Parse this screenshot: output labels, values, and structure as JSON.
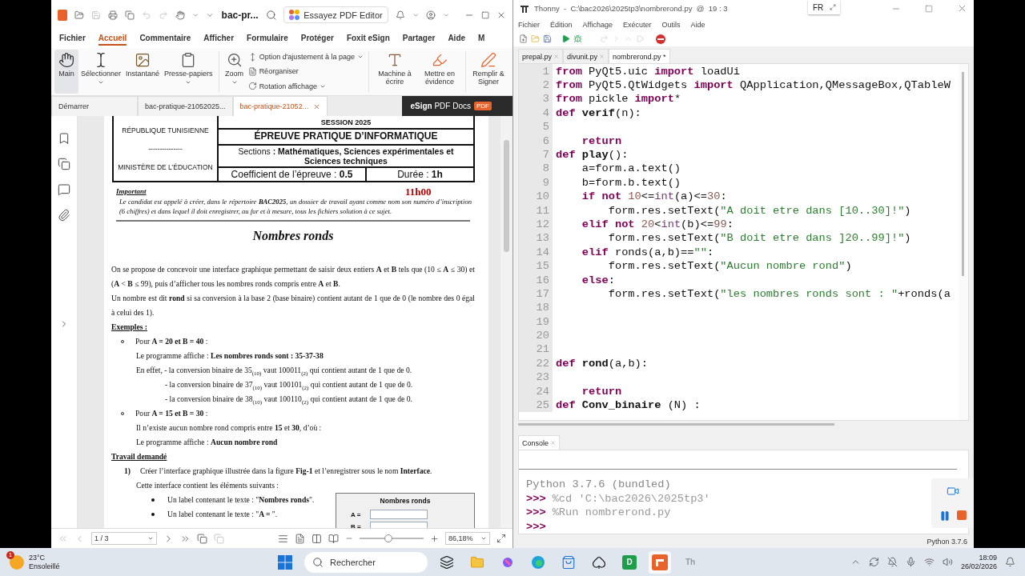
{
  "pdf_window": {
    "title": "bac-pr...",
    "promo_button": "Essayez PDF Editor",
    "menu_tabs": [
      {
        "label": "Fichier",
        "selected": false
      },
      {
        "label": "Accueil",
        "selected": true
      },
      {
        "label": "Commentaire",
        "selected": false
      },
      {
        "label": "Afficher",
        "selected": false
      },
      {
        "label": "Formulaire",
        "selected": false
      },
      {
        "label": "Protéger",
        "selected": false
      },
      {
        "label": "Foxit eSign",
        "selected": false
      },
      {
        "label": "Partager",
        "selected": false
      },
      {
        "label": "Aide",
        "selected": false
      },
      {
        "label": "M",
        "selected": false
      }
    ],
    "tools": [
      {
        "kind": "hand",
        "label": "Main",
        "selected": true,
        "dropdown": false
      },
      {
        "kind": "select",
        "label": "Sélectionner",
        "selected": false,
        "dropdown": true
      },
      {
        "kind": "snapshot",
        "label": "Instantané",
        "selected": false,
        "dropdown": false
      },
      {
        "kind": "clipboard",
        "label": "Presse-papiers",
        "selected": false,
        "dropdown": true
      },
      {
        "kind": "zoom",
        "label": "Zoom",
        "selected": false,
        "dropdown": true
      }
    ],
    "view_options": [
      {
        "kind": "fit",
        "label": "Option d'ajustement à la page",
        "dropdown": true
      },
      {
        "kind": "reorder",
        "label": "Réorganiser",
        "dropdown": false
      },
      {
        "kind": "rotate",
        "label": "Rotation affichage",
        "dropdown": true
      }
    ],
    "edit_tools": [
      {
        "kind": "typewriter",
        "label": "Machine à écrire"
      },
      {
        "kind": "highlight",
        "label": "Mettre en évidence"
      },
      {
        "kind": "sign",
        "label": "Remplir & Signer"
      }
    ],
    "doc_tabs": [
      {
        "label": "Démarrer",
        "selected": false
      },
      {
        "label": "bac-pratique-21052025...",
        "selected": false
      },
      {
        "label": "bac-pratique-21052...",
        "selected": true
      }
    ],
    "esign_banner": {
      "text": "**eSign** PDF Docs",
      "badge": "PDF"
    },
    "document": {
      "header_left": [
        "RÉPUBLIQUE TUNISIENNE",
        "---------------",
        "MINISTÈRE DE L’ÉDUCATION"
      ],
      "session": "SESSION 2025",
      "exam_title": "ÉPREUVE PRATIQUE D’INFORMATIQUE",
      "sections": "Sections **: Mathématiques, Sciences expérimentales et Sciences techniques**",
      "coefficient": "Coefficient de l’épreuve : **0.5**",
      "duration": "Durée : **1h**",
      "important_label": "Important",
      "note": "Le candidat est appelé à créer, dans le répertoire **BAC2025**, un dossier de travail ayant comme nom son numéro d’inscription (6 chiffres) et dans lequel il doit enregistrer, au fur et à mesure, tous les fichiers solution à ce sujet.",
      "time_note": "11h00",
      "title": "Nombres ronds",
      "blocks": [
        {
          "kind": "para",
          "text": "On se propose de concevoir une interface graphique permettant de saisir deux entiers **A** et **B** tels que (10 ≤ **A** ≤ 30) et (**A** < **B** ≤ 99), puis d’afficher tous les nombres ronds compris entre **A** et **B**."
        },
        {
          "kind": "para",
          "text": "Un nombre est dit **rond** si sa conversion à la base 2 (base binaire) contient autant de 1 que de 0 (le nombre des 0 égal à celui des 1)."
        },
        {
          "kind": "heading",
          "text": "Exemples :"
        },
        {
          "kind": "circle",
          "text": "Pour **A = 20 et B = 40** :"
        },
        {
          "kind": "indent",
          "text": "Le programme affiche : **Les nombres ronds sont : 35-37-38**"
        },
        {
          "kind": "indent",
          "text": "En effet, - la conversion binaire de 35$_{(10)}$ vaut 100011$_{(2)}$ qui contient autant de 1 que de 0."
        },
        {
          "kind": "subindent",
          "text": "- la conversion binaire de 37$_{(10)}$ vaut 100101$_{(2)}$ qui contient autant de 1 que de 0."
        },
        {
          "kind": "subindent",
          "text": "- la conversion binaire de 38$_{(10)}$ vaut 100110$_{(2)}$ qui contient autant de 1 que de 0."
        },
        {
          "kind": "circle",
          "text": "Pour **A = 15 et B = 30** :"
        },
        {
          "kind": "indent",
          "text": "Il n’existe aucun nombre rond compris entre **15** et **30**, d’où :"
        },
        {
          "kind": "indent",
          "text": "Le programme affiche : **Aucun nombre rond**"
        },
        {
          "kind": "heading",
          "text": "Travail demandé"
        },
        {
          "kind": "numbered",
          "number": "1)",
          "text": "Créer l’interface graphique illustrée dans la figure **Fig-1** et l’enregistrer sous le nom **Interface**."
        },
        {
          "kind": "indent",
          "text": "Cette interface contient les éléments suivants :"
        }
      ],
      "elements": [
        "Un label contenant le texte : \"**Nombres ronds**\".",
        "Un label contenant le texte : \"**A =** \"."
      ],
      "figure": {
        "title": "Nombres ronds",
        "labels": [
          "A =",
          "B ="
        ]
      }
    },
    "status": {
      "page": "1 / 3",
      "zoom": "86,18%",
      "level": 0.45
    }
  },
  "thonny": {
    "title": "Thonny  -  C:\\bac2026\\2025tp3\\nombrerond.py  @  19 : 3",
    "language": "FR",
    "menu": [
      "Fichier",
      "Édition",
      "Affichage",
      "Exécuter",
      "Outils",
      "Aide"
    ],
    "tabs": [
      {
        "label": "prepal.py",
        "selected": false
      },
      {
        "label": "divunit.py",
        "selected": false
      },
      {
        "label": "nombrerond.py *",
        "selected": true
      }
    ],
    "lines": [
      {
        "number": "1",
        "tokens": [
          {
            "kind": "kw",
            "text": "from"
          },
          {
            "kind": "txt",
            "text": " PyQt5.uic "
          },
          {
            "kind": "kw",
            "text": "import"
          },
          {
            "kind": "txt",
            "text": " loadUi"
          }
        ]
      },
      {
        "number": "2",
        "tokens": [
          {
            "kind": "kw",
            "text": "from"
          },
          {
            "kind": "txt",
            "text": " PyQt5.QtWidgets "
          },
          {
            "kind": "kw",
            "text": "import"
          },
          {
            "kind": "txt",
            "text": " QApplication,QMessageBox,QTableW"
          }
        ]
      },
      {
        "number": "3",
        "tokens": [
          {
            "kind": "kw",
            "text": "from"
          },
          {
            "kind": "txt",
            "text": " pickle "
          },
          {
            "kind": "kw",
            "text": "import"
          },
          {
            "kind": "txt",
            "text": "*"
          }
        ]
      },
      {
        "number": "4",
        "tokens": [
          {
            "kind": "kw",
            "text": "def"
          },
          {
            "kind": "fn",
            "text": " verif"
          },
          {
            "kind": "txt",
            "text": "(n):"
          }
        ]
      },
      {
        "number": "5"
      },
      {
        "number": "6",
        "tokens": [
          {
            "kind": "kw",
            "text": "    return"
          }
        ]
      },
      {
        "number": "7",
        "tokens": [
          {
            "kind": "kw",
            "text": "def"
          },
          {
            "kind": "fn",
            "text": " play"
          },
          {
            "kind": "txt",
            "text": "():"
          }
        ]
      },
      {
        "number": "8",
        "tokens": [
          {
            "kind": "txt",
            "text": "    a=form.a.text()"
          }
        ]
      },
      {
        "number": "9",
        "tokens": [
          {
            "kind": "txt",
            "text": "    b=form.b.text()"
          }
        ]
      },
      {
        "number": "10",
        "tokens": [
          {
            "kind": "kw",
            "text": "    if"
          },
          {
            "kind": "kw",
            "text": " not"
          },
          {
            "kind": "num",
            "text": " 10"
          },
          {
            "kind": "txt",
            "text": "<="
          },
          {
            "kind": "builtin",
            "text": "int"
          },
          {
            "kind": "txt",
            "text": "(a)<="
          },
          {
            "kind": "num",
            "text": "30"
          },
          {
            "kind": "txt",
            "text": ":"
          }
        ]
      },
      {
        "number": "11",
        "tokens": [
          {
            "kind": "txt",
            "text": "        form.res.setText("
          },
          {
            "kind": "str",
            "text": "\"A doit etre dans [10..30]!\""
          },
          {
            "kind": "txt",
            "text": ")"
          }
        ]
      },
      {
        "number": "12",
        "tokens": [
          {
            "kind": "kw",
            "text": "    elif"
          },
          {
            "kind": "kw",
            "text": " not"
          },
          {
            "kind": "num",
            "text": " 20"
          },
          {
            "kind": "txt",
            "text": "<"
          },
          {
            "kind": "builtin",
            "text": "int"
          },
          {
            "kind": "txt",
            "text": "(b)<="
          },
          {
            "kind": "num",
            "text": "99"
          },
          {
            "kind": "txt",
            "text": ":"
          }
        ]
      },
      {
        "number": "13",
        "tokens": [
          {
            "kind": "txt",
            "text": "        form.res.setText("
          },
          {
            "kind": "str",
            "text": "\"B doit etre dans ]20..99]!\""
          },
          {
            "kind": "txt",
            "text": ")"
          }
        ]
      },
      {
        "number": "14",
        "tokens": [
          {
            "kind": "kw",
            "text": "    elif"
          },
          {
            "kind": "txt",
            "text": " ronds(a,b)=="
          },
          {
            "kind": "str",
            "text": "\"\""
          },
          {
            "kind": "txt",
            "text": ":"
          }
        ]
      },
      {
        "number": "15",
        "tokens": [
          {
            "kind": "txt",
            "text": "        form.res.setText("
          },
          {
            "kind": "str",
            "text": "\"Aucun nombre rond\""
          },
          {
            "kind": "txt",
            "text": ")"
          }
        ]
      },
      {
        "number": "16",
        "tokens": [
          {
            "kind": "kw",
            "text": "    else"
          },
          {
            "kind": "txt",
            "text": ":"
          }
        ]
      },
      {
        "number": "17",
        "tokens": [
          {
            "kind": "txt",
            "text": "        form.res.setText("
          },
          {
            "kind": "str",
            "text": "\"les nombres ronds sont : \""
          },
          {
            "kind": "txt",
            "text": "+ronds(a"
          }
        ]
      },
      {
        "number": "18"
      },
      {
        "number": "19"
      },
      {
        "number": "20"
      },
      {
        "number": "21"
      },
      {
        "number": "22",
        "tokens": [
          {
            "kind": "kw",
            "text": "def"
          },
          {
            "kind": "fn",
            "text": " rond"
          },
          {
            "kind": "txt",
            "text": "(a,b):"
          }
        ]
      },
      {
        "number": "23"
      },
      {
        "number": "24",
        "tokens": [
          {
            "kind": "kw",
            "text": "    return"
          }
        ]
      },
      {
        "number": "25",
        "tokens": [
          {
            "kind": "kw",
            "text": "def"
          },
          {
            "kind": "fn",
            "text": " Conv_binaire"
          },
          {
            "kind": "txt",
            "text": " (N) :"
          }
        ]
      }
    ],
    "console_tab": "Console",
    "console": [
      {
        "kind": "info",
        "text": "Python 3.7.6 (bundled)"
      },
      {
        "kind": "command",
        "prompt": ">>>",
        "text": "%cd 'C:\\bac2026\\2025tp3'"
      },
      {
        "kind": "command",
        "prompt": ">>>",
        "text": "%Run nombrerond.py"
      },
      {
        "kind": "command",
        "prompt": ">>>"
      }
    ],
    "status": "Python 3.7.6"
  },
  "taskbar": {
    "weather": {
      "temperature": "23°C",
      "condition": "Ensoleillé",
      "badge": "1"
    },
    "search": {
      "placeholder": "Rechercher"
    },
    "apps": [
      {
        "kind": "start",
        "selected": false
      },
      {
        "kind": "taskview",
        "selected": false
      },
      {
        "kind": "explorer",
        "selected": false
      },
      {
        "kind": "copilot",
        "selected": false
      },
      {
        "kind": "edge",
        "selected": false
      },
      {
        "kind": "store",
        "selected": false
      },
      {
        "kind": "cards",
        "selected": false
      },
      {
        "kind": "green",
        "selected": false,
        "label": "D"
      },
      {
        "kind": "foxit",
        "selected": true
      },
      {
        "kind": "thonny",
        "selected": false,
        "label": "Th"
      }
    ],
    "time": "18:09",
    "date": "26/02/2026"
  }
}
